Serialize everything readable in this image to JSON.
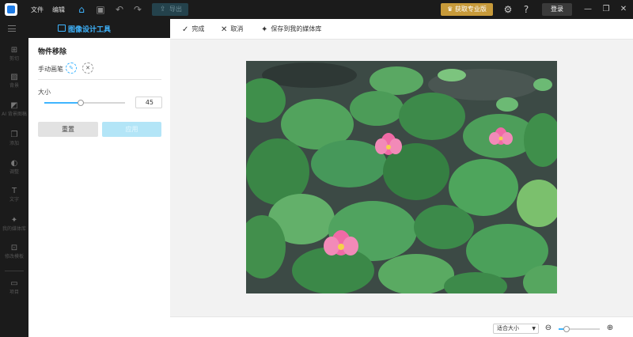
{
  "topbar": {
    "menu": [
      "文件",
      "编辑"
    ],
    "export_label": "导出",
    "pro_label": "获取专业版",
    "login_label": "登录"
  },
  "rail": {
    "header_title": "图像设计工具",
    "items": [
      {
        "icon": "crop-icon",
        "label": "剪切",
        "glyph": "⊞"
      },
      {
        "icon": "texture-icon",
        "label": "背景",
        "glyph": "▨"
      },
      {
        "icon": "ai-background-icon",
        "label": "AI 背景图稿",
        "glyph": "◩"
      },
      {
        "icon": "layers-icon",
        "label": "添加",
        "glyph": "❐"
      },
      {
        "icon": "palette-icon",
        "label": "调整",
        "glyph": "◐"
      },
      {
        "icon": "text-icon",
        "label": "文字",
        "glyph": "T"
      },
      {
        "icon": "sparkle-icon",
        "label": "我的媒体库",
        "glyph": "✦"
      },
      {
        "icon": "template-icon",
        "label": "修改模板",
        "glyph": "⊡"
      },
      {
        "icon": "folder-icon",
        "label": "项目",
        "glyph": "▭"
      }
    ]
  },
  "panel": {
    "title": "物件移除",
    "brush_label": "手动画笔",
    "size_label": "大小",
    "size_value": "45",
    "size_fraction": 0.45,
    "reset_label": "重置",
    "apply_label": "应用"
  },
  "toolbar": {
    "done_label": "完成",
    "cancel_label": "取消",
    "save_label": "保存到我的媒体库"
  },
  "bottombar": {
    "fit_label": "适合大小",
    "zoom_fraction": 0.2
  },
  "colors": {
    "accent": "#3fb5ff",
    "pro_gold": "#c79a3a",
    "dark": "#1b1b1b"
  }
}
